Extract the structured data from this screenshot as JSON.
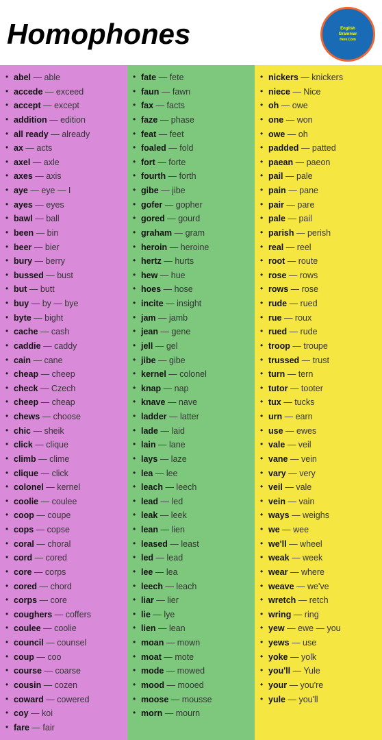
{
  "header": {
    "title": "Homophones",
    "logo_text": "English\nGrammar\nHere.Com"
  },
  "columns": [
    {
      "id": "col1",
      "bg": "#d98bd9",
      "items": [
        [
          "abel",
          "able"
        ],
        [
          "accede",
          "exceed"
        ],
        [
          "accept",
          "except"
        ],
        [
          "addition",
          "edition"
        ],
        [
          "all ready",
          "already"
        ],
        [
          "ax",
          "acts"
        ],
        [
          "axel",
          "axle"
        ],
        [
          "axes",
          "axis"
        ],
        [
          "aye",
          "eye — I"
        ],
        [
          "ayes",
          "eyes"
        ],
        [
          "bawl",
          "ball"
        ],
        [
          "been",
          "bin"
        ],
        [
          "beer",
          "bier"
        ],
        [
          "bury",
          "berry"
        ],
        [
          "bussed",
          "bust"
        ],
        [
          "but",
          "butt"
        ],
        [
          "buy",
          "by — bye"
        ],
        [
          "byte",
          "bight"
        ],
        [
          "cache",
          "cash"
        ],
        [
          "caddie",
          "caddy"
        ],
        [
          "cain",
          "cane"
        ],
        [
          "cheap",
          "cheep"
        ],
        [
          "check",
          "Czech"
        ],
        [
          "cheep",
          "cheap"
        ],
        [
          "chews",
          "choose"
        ],
        [
          "chic",
          "sheik"
        ],
        [
          "click",
          "clique"
        ],
        [
          "climb",
          "clime"
        ],
        [
          "clique",
          "click"
        ],
        [
          "colonel",
          "kernel"
        ],
        [
          "coolie",
          "coulee"
        ],
        [
          "coop",
          "coupe"
        ],
        [
          "cops",
          "copse"
        ],
        [
          "coral",
          "choral"
        ],
        [
          "cord",
          "cored"
        ],
        [
          "core",
          "corps"
        ],
        [
          "cored",
          "chord"
        ],
        [
          "corps",
          "core"
        ],
        [
          "coughers",
          "coffers"
        ],
        [
          "coulee",
          "coolie"
        ],
        [
          "council",
          "counsel"
        ],
        [
          "coup",
          "coo"
        ],
        [
          "course",
          "coarse"
        ],
        [
          "cousin",
          "cozen"
        ],
        [
          "coward",
          "cowered"
        ],
        [
          "coy",
          "koi"
        ],
        [
          "fare",
          "fair"
        ]
      ]
    },
    {
      "id": "col2",
      "bg": "#7dc87d",
      "items": [
        [
          "fate",
          "fete"
        ],
        [
          "faun",
          "fawn"
        ],
        [
          "fax",
          "facts"
        ],
        [
          "faze",
          "phase"
        ],
        [
          "feat",
          "feet"
        ],
        [
          "foaled",
          "fold"
        ],
        [
          "fort",
          "forte"
        ],
        [
          "fourth",
          "forth"
        ],
        [
          "gibe",
          "jibe"
        ],
        [
          "gofer",
          "gopher"
        ],
        [
          "gored",
          "gourd"
        ],
        [
          "graham",
          "gram"
        ],
        [
          "heroin",
          "heroine"
        ],
        [
          "hertz",
          "hurts"
        ],
        [
          "hew",
          "hue"
        ],
        [
          "hoes",
          "hose"
        ],
        [
          "incite",
          "insight"
        ],
        [
          "jam",
          "jamb"
        ],
        [
          "jean",
          "gene"
        ],
        [
          "jell",
          "gel"
        ],
        [
          "jibe",
          "gibe"
        ],
        [
          "kernel",
          "colonel"
        ],
        [
          "knap",
          "nap"
        ],
        [
          "knave",
          "nave"
        ],
        [
          "ladder",
          "latter"
        ],
        [
          "lade",
          "laid"
        ],
        [
          "lain",
          "lane"
        ],
        [
          "lays",
          "laze"
        ],
        [
          "lea",
          "lee"
        ],
        [
          "leach",
          "leech"
        ],
        [
          "lead",
          "led"
        ],
        [
          "leak",
          "leek"
        ],
        [
          "lean",
          "lien"
        ],
        [
          "leased",
          "least"
        ],
        [
          "led",
          "lead"
        ],
        [
          "lee",
          "lea"
        ],
        [
          "leech",
          "leach"
        ],
        [
          "liar",
          "lier"
        ],
        [
          "lie",
          "lye"
        ],
        [
          "lien",
          "lean"
        ],
        [
          "moan",
          "mown"
        ],
        [
          "moat",
          "mote"
        ],
        [
          "mode",
          "mowed"
        ],
        [
          "mood",
          "mooed"
        ],
        [
          "moose",
          "mousse"
        ],
        [
          "morn",
          "mourn"
        ]
      ]
    },
    {
      "id": "col3",
      "bg": "#f5e642",
      "items": [
        [
          "nickers",
          "knickers"
        ],
        [
          "niece",
          "Nice"
        ],
        [
          "oh",
          "owe"
        ],
        [
          "one",
          "won"
        ],
        [
          "owe",
          "oh"
        ],
        [
          "padded",
          "patted"
        ],
        [
          "paean",
          "paeon"
        ],
        [
          "pail",
          "pale"
        ],
        [
          "pain",
          "pane"
        ],
        [
          "pair",
          "pare"
        ],
        [
          "pale",
          "pail"
        ],
        [
          "parish",
          "perish"
        ],
        [
          "real",
          "reel"
        ],
        [
          "root",
          "route"
        ],
        [
          "rose",
          "rows"
        ],
        [
          "rows",
          "rose"
        ],
        [
          "rude",
          "rued"
        ],
        [
          "rue",
          "roux"
        ],
        [
          "rued",
          "rude"
        ],
        [
          "troop",
          "troupe"
        ],
        [
          "trussed",
          "trust"
        ],
        [
          "turn",
          "tern"
        ],
        [
          "tutor",
          "tooter"
        ],
        [
          "tux",
          "tucks"
        ],
        [
          "urn",
          "earn"
        ],
        [
          "use",
          "ewes"
        ],
        [
          "vale",
          "veil"
        ],
        [
          "vane",
          "vein"
        ],
        [
          "vary",
          "very"
        ],
        [
          "veil",
          "vale"
        ],
        [
          "vein",
          "vain"
        ],
        [
          "ways",
          "weighs"
        ],
        [
          "we",
          "wee"
        ],
        [
          "we'll",
          "wheel"
        ],
        [
          "weak",
          "week"
        ],
        [
          "wear",
          "where"
        ],
        [
          "weave",
          "we've"
        ],
        [
          "wretch",
          "retch"
        ],
        [
          "wring",
          "ring"
        ],
        [
          "yew",
          "ewe — you"
        ],
        [
          "yews",
          "use"
        ],
        [
          "yoke",
          "yolk"
        ],
        [
          "you'll",
          "Yule"
        ],
        [
          "your",
          "you're"
        ],
        [
          "yule",
          "you'll"
        ]
      ]
    }
  ]
}
